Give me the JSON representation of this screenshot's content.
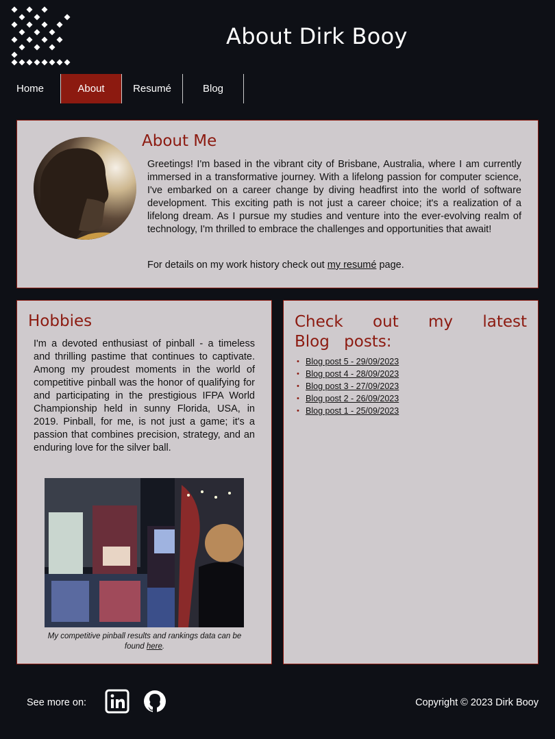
{
  "site": {
    "title": "About Dirk Booy",
    "logo_icon": "diamond-pattern-logo-icon"
  },
  "nav": {
    "items": [
      {
        "label": "Home",
        "active": false
      },
      {
        "label": "About",
        "active": true
      },
      {
        "label": "Resumé",
        "active": false
      },
      {
        "label": "Blog",
        "active": false
      }
    ]
  },
  "about": {
    "heading": "About Me",
    "paragraph": "Greetings! I'm based in the vibrant city of Brisbane, Australia, where I am currently immersed in a transformative journey. With a lifelong passion for computer science, I've embarked on a career change by diving headfirst into the world of software development. This exciting path is not just a career choice; it's a realization of a lifelong dream. As I pursue my studies and venture into the ever-evolving realm of technology, I'm thrilled to embrace the challenges and opportunities that await!",
    "detail_prefix": "For details on my work history check out ",
    "detail_link": "my resumé",
    "detail_suffix": " page."
  },
  "hobbies": {
    "heading": "Hobbies",
    "paragraph": "I'm a devoted enthusiast of pinball - a timeless and thrilling pastime that continues to captivate. Among my proudest moments in the world of competitive pinball was the honor of qualifying for and participating in the prestigious IFPA World Championship held in sunny Florida, USA, in 2019. Pinball, for me, is not just a game; it's a passion that combines precision, strategy, and an enduring love for the silver ball.",
    "caption_prefix": "My competitive pinball results and rankings data can be found ",
    "caption_link": "here",
    "caption_suffix": "."
  },
  "blog": {
    "heading": "Check out my latest Blog posts:",
    "posts": [
      "Blog post 5 - 29/09/2023",
      "Blog post 4 - 28/09/2023",
      "Blog post 3 - 27/09/2023",
      "Blog post 2 - 26/09/2023",
      "Blog post 1 - 25/09/2023"
    ]
  },
  "footer": {
    "see_more": "See more on:",
    "copyright": "Copyright © 2023 Dirk Booy",
    "icons": [
      "linkedin-icon",
      "github-icon"
    ]
  },
  "colors": {
    "background": "#0e1016",
    "accent": "#8c1a10",
    "panel": "#cfcacd"
  }
}
